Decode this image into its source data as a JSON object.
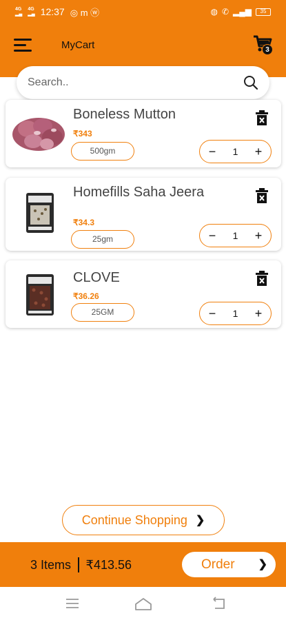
{
  "status_bar": {
    "time": "12:37",
    "network_left": "4G",
    "battery": "35"
  },
  "header": {
    "title": "MyCart",
    "cart_count": "3"
  },
  "search": {
    "placeholder": "Search.."
  },
  "cart_items": [
    {
      "name": "Boneless Mutton",
      "price": "₹343",
      "unit": "500gm",
      "quantity": "1",
      "image": "mutton-image"
    },
    {
      "name": "Homefills Saha Jeera",
      "price": "₹34.3",
      "unit": "25gm",
      "quantity": "1",
      "image": "jeera-pack-image"
    },
    {
      "name": "CLOVE",
      "price": "₹36.26",
      "unit": "25GM",
      "quantity": "1",
      "image": "clove-pack-image"
    }
  ],
  "continue_label": "Continue Shopping",
  "footer": {
    "items": "3 Items",
    "total": "₹413.56",
    "order_label": "Order"
  },
  "colors": {
    "accent": "#f07f0c",
    "text": "#444444"
  }
}
